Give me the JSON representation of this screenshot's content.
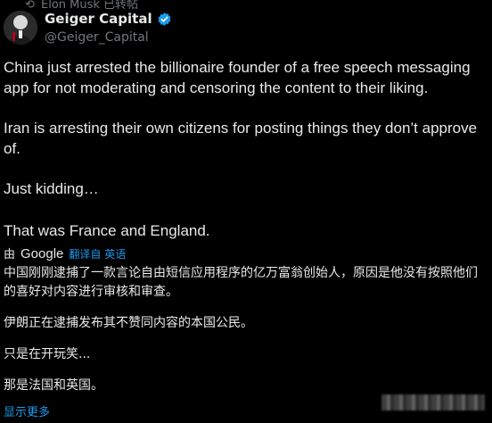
{
  "repost": {
    "label": "Elon Musk 已转帖",
    "icon": "repost-icon"
  },
  "author": {
    "display_name": "Geiger Capital",
    "handle": "@Geiger_Capital",
    "verified_icon": "verified-badge-icon",
    "verified_color": "#1d9bf0"
  },
  "tweet": {
    "paragraphs": [
      "China just arrested the billionaire founder of a free speech messaging app for not moderating and censoring the content to their liking.",
      "Iran is arresting their own citizens for posting things they don’t approve of.",
      "Just kidding…",
      "That was France and England."
    ]
  },
  "translation": {
    "by_label": "由",
    "provider": "Google",
    "link_label": "翻译自 英语",
    "paragraphs": [
      "中国刚刚逮捕了一款言论自由短信应用程序的亿万富翁创始人，原因是他没有按照他们的喜好对内容进行审核和审查。",
      "伊朗正在逮捕发布其不赞同内容的本国公民。",
      "只是在开玩笑...",
      "那是法国和英国。"
    ],
    "show_more_label": "显示更多"
  },
  "colors": {
    "background": "#000000",
    "text": "#e7e9ea",
    "muted": "#71767b",
    "accent": "#1d9bf0"
  }
}
